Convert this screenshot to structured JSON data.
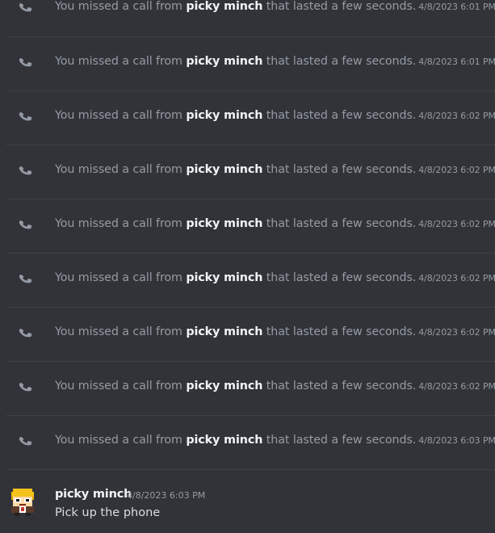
{
  "calls": [
    {
      "prefix": "You missed a call from ",
      "user": "picky minch",
      "suffix": " that lasted a few seconds.",
      "timestamp": "4/8/2023 6:01 PM"
    },
    {
      "prefix": "You missed a call from ",
      "user": "picky minch",
      "suffix": " that lasted a few seconds.",
      "timestamp": "4/8/2023 6:01 PM"
    },
    {
      "prefix": "You missed a call from ",
      "user": "picky minch",
      "suffix": " that lasted a few seconds.",
      "timestamp": "4/8/2023 6:02 PM"
    },
    {
      "prefix": "You missed a call from ",
      "user": "picky minch",
      "suffix": " that lasted a few seconds.",
      "timestamp": "4/8/2023 6:02 PM"
    },
    {
      "prefix": "You missed a call from ",
      "user": "picky minch",
      "suffix": " that lasted a few seconds.",
      "timestamp": "4/8/2023 6:02 PM"
    },
    {
      "prefix": "You missed a call from ",
      "user": "picky minch",
      "suffix": " that lasted a few seconds.",
      "timestamp": "4/8/2023 6:02 PM"
    },
    {
      "prefix": "You missed a call from ",
      "user": "picky minch",
      "suffix": " that lasted a few seconds.",
      "timestamp": "4/8/2023 6:02 PM"
    },
    {
      "prefix": "You missed a call from ",
      "user": "picky minch",
      "suffix": " that lasted a few seconds.",
      "timestamp": "4/8/2023 6:02 PM"
    },
    {
      "prefix": "You missed a call from ",
      "user": "picky minch",
      "suffix": " that lasted a few seconds.",
      "timestamp": "4/8/2023 6:03 PM"
    }
  ],
  "message": {
    "author": "picky minch",
    "timestamp": "4/8/2023 6:03 PM",
    "text": "Pick up the phone",
    "avatar_icon": "pixel-character-avatar"
  },
  "icons": {
    "call": "phone-icon"
  },
  "colors": {
    "background": "#313338",
    "muted_text": "#949ba4",
    "username": "#f2f3f5",
    "body_text": "#dbdee1",
    "divider": "#3f4147"
  }
}
